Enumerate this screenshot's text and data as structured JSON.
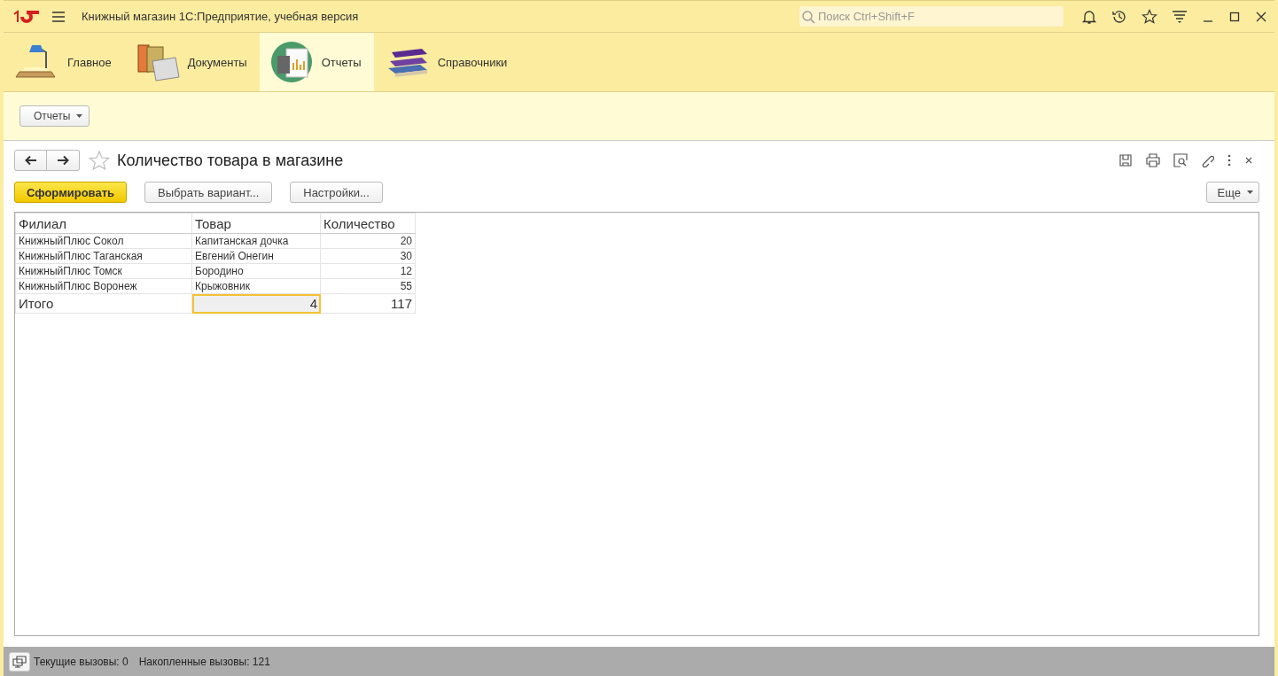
{
  "window": {
    "title": "Книжный магазин 1С:Предприятие, учебная версия"
  },
  "search": {
    "placeholder": "Поиск Ctrl+Shift+F"
  },
  "sections": [
    {
      "label": "Главное",
      "selected": false
    },
    {
      "label": "Документы",
      "selected": false
    },
    {
      "label": "Отчеты",
      "selected": true
    },
    {
      "label": "Справочники",
      "selected": false
    }
  ],
  "command_bar": {
    "menu_button": "Отчеты"
  },
  "form": {
    "title": "Количество товара в магазине",
    "buttons": [
      {
        "label": "Сформировать",
        "kind": "primary"
      },
      {
        "label": "Выбрать вариант...",
        "kind": "normal"
      },
      {
        "label": "Настройки...",
        "kind": "normal"
      }
    ],
    "more_button": "Еще"
  },
  "table": {
    "columns": [
      "Филиал",
      "Товар",
      "Количество"
    ],
    "rows": [
      [
        "КнижныйПлюс Сокол",
        "Капитанская дочка",
        "20"
      ],
      [
        "КнижныйПлюс Таганская",
        "Евгений Онегин",
        "30"
      ],
      [
        "КнижныйПлюс Томск",
        "Бородино",
        "12"
      ],
      [
        "КнижныйПлюс Воронеж",
        "Крыжовник",
        "55"
      ]
    ],
    "totals": [
      {
        "text": "Итого",
        "selected": false
      },
      {
        "text": "4",
        "selected": true
      },
      {
        "text": "117",
        "selected": false
      }
    ]
  },
  "status_bar": {
    "current_calls": "Текущие вызовы: 0",
    "accumulated_calls": "Накопленные вызовы: 121"
  }
}
